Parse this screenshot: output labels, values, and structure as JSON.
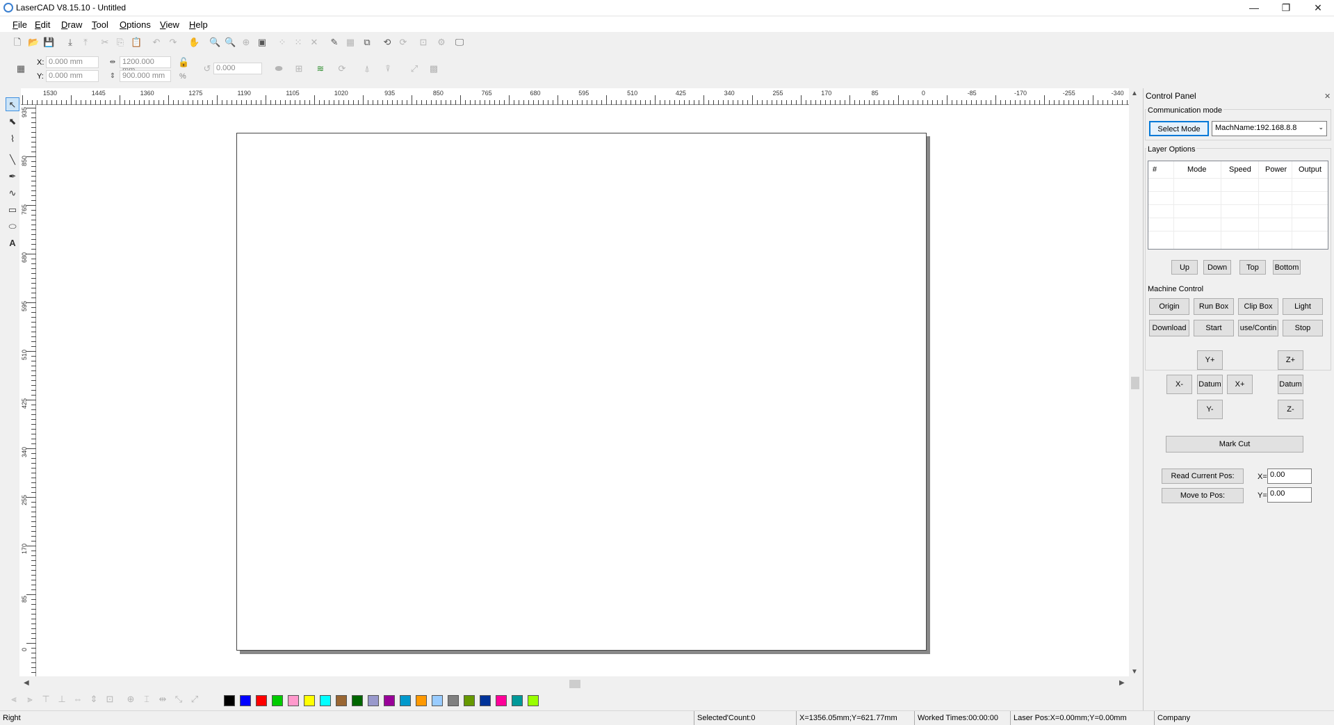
{
  "window": {
    "title": "LaserCAD V8.15.10 - Untitled",
    "minimize": "—",
    "maximize": "❐",
    "close": "✕"
  },
  "menu": [
    "File",
    "Edit",
    "Draw",
    "Tool",
    "Options",
    "View",
    "Help"
  ],
  "toolbar": {
    "x_label": "X:",
    "x_value": "0.000 mm",
    "y_label": "Y:",
    "y_value": "0.000 mm",
    "width_value": "1200.000 mm",
    "height_value": "900.000 mm",
    "percent": "%",
    "rotate_value": "0.000"
  },
  "rulers": {
    "horizontal": [
      "1530",
      "1445",
      "1360",
      "1275",
      "1190",
      "1105",
      "1020",
      "935",
      "850",
      "765",
      "680",
      "595",
      "510",
      "425",
      "340",
      "255",
      "170",
      "85",
      "0",
      "-85",
      "-170",
      "-255",
      "-340"
    ],
    "vertical": [
      "935",
      "850",
      "765",
      "680",
      "595",
      "510",
      "425",
      "340",
      "255",
      "170",
      "85",
      "0"
    ]
  },
  "palette": [
    "#000000",
    "#0000ff",
    "#ff0000",
    "#00cc00",
    "#ff99cc",
    "#ffff00",
    "#00ffff",
    "#996633",
    "#006600",
    "#9999cc",
    "#990099",
    "#0099cc",
    "#ff9900",
    "#99ccff",
    "#808080",
    "#669900",
    "#003399",
    "#ff0099",
    "#009999",
    "#99ff00"
  ],
  "status": {
    "mode": "Right",
    "selected": "Selected'Count:0",
    "position": "X=1356.05mm;Y=621.77mm",
    "worked": "Worked Times:00:00:00",
    "laser_pos": "Laser Pos:X=0.00mm;Y=0.00mm",
    "company": "Company"
  },
  "control_panel": {
    "title": "Control Panel",
    "close": "✕",
    "communication_mode": "Communication mode",
    "select_mode": "Select Mode",
    "machine_name": "MachName:192.168.8.8",
    "layer_options": "Layer Options",
    "columns": [
      "#",
      "Mode",
      "Speed",
      "Power",
      "Output"
    ],
    "layer_buttons": [
      "Up",
      "Down",
      "Top",
      "Bottom"
    ],
    "machine_control": "Machine Control",
    "row1": [
      "Origin",
      "Run Box",
      "Clip Box",
      "Light"
    ],
    "row2": [
      "Download",
      "Start",
      "use/Contin",
      "Stop"
    ],
    "jog": {
      "y_plus": "Y+",
      "y_minus": "Y-",
      "x_plus": "X+",
      "x_minus": "X-",
      "datum": "Datum",
      "z_plus": "Z+",
      "z_minus": "Z-",
      "z_datum": "Datum"
    },
    "mark_cut": "Mark Cut",
    "read_pos": "Read Current Pos:",
    "move_pos": "Move to Pos:",
    "x_eq": "X=",
    "y_eq": "Y=",
    "x_val": "0.00",
    "y_val": "0.00"
  }
}
